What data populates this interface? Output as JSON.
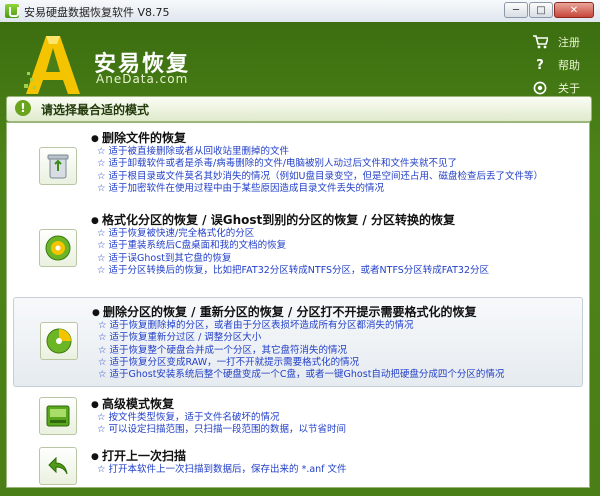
{
  "window": {
    "title": "安易硬盘数据恢复软件 V8.75",
    "buttons": {
      "minimize": "─",
      "maximize": "□",
      "close": "✕"
    }
  },
  "brand": {
    "name": "安易恢复",
    "site": "AneData.com"
  },
  "tools": [
    {
      "label": "注册",
      "icon": "cart-icon"
    },
    {
      "label": "帮助",
      "icon": "help-icon"
    },
    {
      "label": "关于",
      "icon": "about-icon"
    }
  ],
  "section": {
    "title": "请选择最合适的模式",
    "icon": "warning-icon"
  },
  "options": [
    {
      "title": "删除文件的恢复",
      "icon": "recycle-bin-icon",
      "items": [
        "适于被直接删除或者从回收站里删掉的文件",
        "适于卸载软件或者是杀毒/病毒删除的文件/电脑被别人动过后文件和文件夹就不见了",
        "适于根目录或文件莫名其妙消失的情况（例如U盘目录变空，但是空间还占用、磁盘检查后丢了文件等）",
        "适于加密软件在使用过程中由于某些原因造成目录文件丢失的情况"
      ]
    },
    {
      "title": "格式化分区的恢复 / 误Ghost到别的分区的恢复 / 分区转换的恢复",
      "icon": "disk-format-icon",
      "items": [
        "适于恢复被快速/完全格式化的分区",
        "适于重装系统后C盘桌面和我的文档的恢复",
        "适于误Ghost到其它盘的恢复",
        "适于分区转换后的恢复，比如把FAT32分区转成NTFS分区，或者NTFS分区转成FAT32分区"
      ]
    },
    {
      "title": "删除分区的恢复 / 重新分区的恢复 / 分区打不开提示需要格式化的恢复",
      "icon": "partition-pie-icon",
      "items": [
        "适于恢复删除掉的分区，或者由于分区表损坏造成所有分区都消失的情况",
        "适于恢复重新分过区 / 调整分区大小",
        "适于恢复整个硬盘合并成一个分区，其它盘符消失的情况",
        "适于恢复分区变成RAW，一打不开就提示需要格式化的情况",
        "适于Ghost安装系统后整个硬盘变成一个C盘，或者一键Ghost自动把硬盘分成四个分区的情况"
      ]
    },
    {
      "title": "高级模式恢复",
      "icon": "advanced-drive-icon",
      "items": [
        "按文件类型恢复，适于文件名破坏的情况",
        "可以设定扫描范围，只扫描一段范围的数据，以节省时间"
      ]
    },
    {
      "title": "打开上一次扫描",
      "icon": "back-arrow-icon",
      "items": [
        "打开本软件上一次扫描到数据后，保存出来的 *.anf 文件"
      ]
    }
  ],
  "colors": {
    "frame": "#4a7e16",
    "link_text": "#2340c8",
    "accent": "#6aa41d"
  }
}
